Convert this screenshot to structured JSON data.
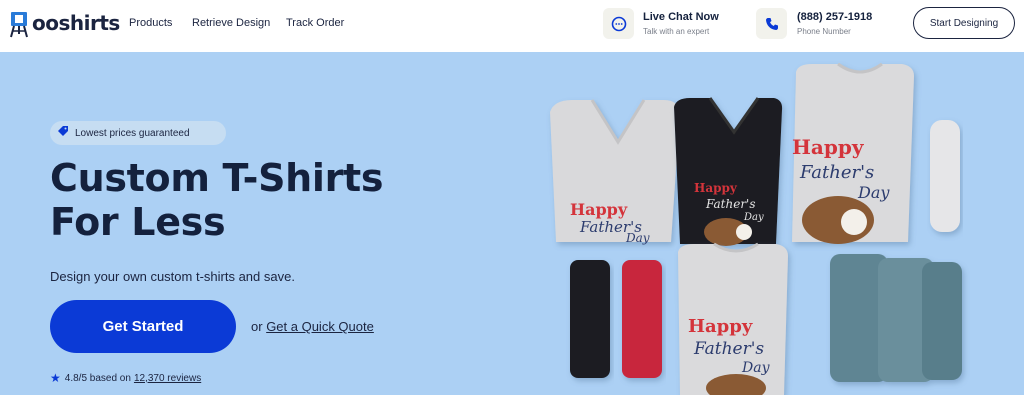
{
  "header": {
    "logo_text": "ooshirts",
    "nav": [
      "Products",
      "Retrieve Design",
      "Track Order"
    ],
    "live_chat": {
      "title": "Live Chat Now",
      "subtitle": "Talk with an expert"
    },
    "phone": {
      "title": "(888) 257-1918",
      "subtitle": "Phone Number"
    },
    "cta_label": "Start Designing"
  },
  "hero": {
    "badge": "Lowest prices guaranteed",
    "headline_line1": "Custom T-Shirts",
    "headline_line2": "For Less",
    "subtitle": "Design your own custom t-shirts and save.",
    "primary_button": "Get Started",
    "or_text": "or",
    "quote_link": "Get a Quick Quote",
    "rating_text": "4.8/5 based on",
    "reviews_link": "12,370 reviews"
  },
  "shirt_print": {
    "line1": "Happy",
    "line2": "Father's",
    "line3": "Day"
  },
  "colors": {
    "hero_bg": "#acd0f4",
    "primary": "#0b3ad6",
    "navy": "#14213d",
    "shirt_gray": "#d8d8da",
    "shirt_black": "#1e1e20",
    "shirt_red": "#c8283e",
    "shirt_teal": "#5f8593",
    "print_red": "#d4343b",
    "print_navy": "#2c3c6e"
  },
  "icons": {
    "logo": "easel-logo-icon",
    "chat": "chat-bubble-icon",
    "phone": "phone-icon",
    "badge": "price-tag-icon",
    "rating": "star-icon"
  }
}
